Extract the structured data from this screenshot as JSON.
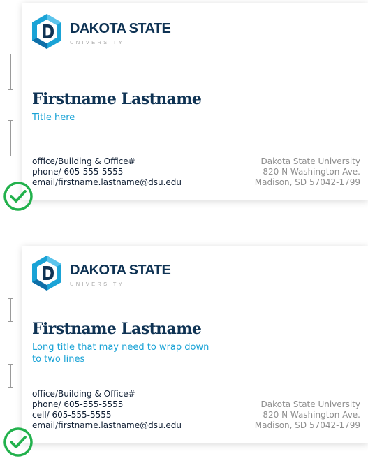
{
  "brand": {
    "wordmark": "DAKOTA STATE",
    "subtitle": "UNIVERSITY",
    "colors": {
      "navy": "#0f3354",
      "cyan": "#1aa3d6",
      "light_blue": "#5bc4ec",
      "check_green": "#22b14c"
    }
  },
  "cards": [
    {
      "name": "Firstname Lastname",
      "title": "Title here",
      "office": "office/Building & Office#",
      "phone": "phone/ 605-555-5555",
      "email": "email/firstname.lastname@dsu.edu",
      "address_line1": "Dakota State University",
      "address_line2": "820 N Washington Ave.",
      "address_line3": "Madison, SD 57042-1799",
      "status_icon": "check-circle-icon"
    },
    {
      "name": "Firstname Lastname",
      "title": "Long title that may need to wrap down to two lines",
      "office": "office/Building & Office#",
      "phone": "phone/ 605-555-5555",
      "cell": "cell/ 605-555-5555",
      "email": "email/firstname.lastname@dsu.edu",
      "address_line1": "Dakota State University",
      "address_line2": "820 N Washington Ave.",
      "address_line3": "Madison, SD 57042-1799",
      "status_icon": "check-circle-icon"
    }
  ]
}
